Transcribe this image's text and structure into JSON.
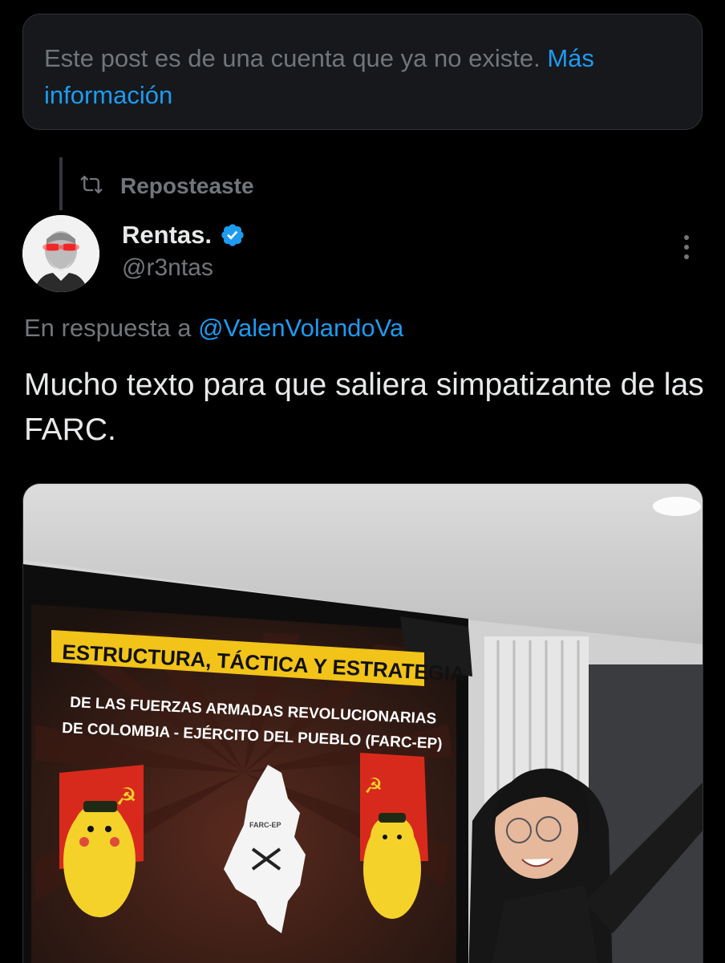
{
  "notice": {
    "text": "Este post es de una cuenta que ya no existe.",
    "link": "Más información"
  },
  "repost": {
    "icon": "repost-icon",
    "label": "Reposteaste"
  },
  "author": {
    "name": "Rentas.",
    "handle": "@r3ntas",
    "verified": true,
    "verified_color": "#1d9bf0"
  },
  "reply": {
    "prefix": "En respuesta a",
    "mention": "@ValenVolandoVa"
  },
  "post": {
    "text": "Mucho texto para que saliera simpatizante de las FARC."
  },
  "media": {
    "poster_title": "ESTRUCTURA, TÁCTICA Y ESTRATEGIA",
    "poster_line1": "DE LAS FUERZAS ARMADAS REVOLUCIONARIAS",
    "poster_line2": "DE COLOMBIA - EJÉRCITO DEL PUEBLO (FARC-EP)",
    "map_label": "FARC-EP"
  },
  "colors": {
    "accent": "#1d9bf0",
    "muted": "#71767b",
    "text": "#e7e9ea",
    "background": "#000000"
  }
}
